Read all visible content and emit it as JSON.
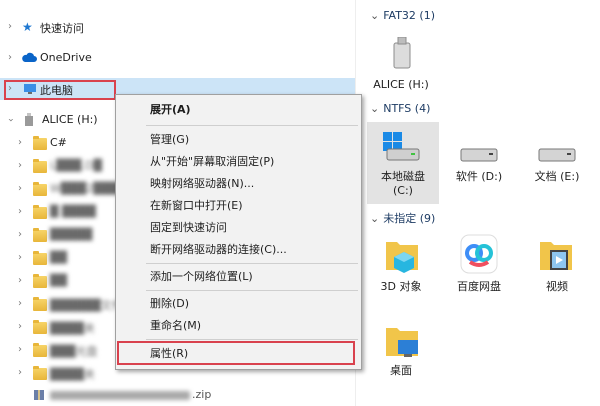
{
  "nav": {
    "quick_access": "快速访问",
    "onedrive": "OneDrive",
    "this_pc": "此电脑",
    "drive": "ALICE (H:)",
    "folders": [
      "C#",
      "L███.D█",
      "W███2███",
      "█ ████",
      "█████",
      "██",
      "██",
      "██████文件",
      "████夹",
      "███光盘",
      "████夹"
    ],
    "zip_suffix": ".zip"
  },
  "content": {
    "groups": [
      {
        "title": "FAT32 (1)",
        "items": [
          {
            "label": "ALICE (H:)",
            "icon": "usb-drive-icon"
          }
        ]
      },
      {
        "title": "NTFS (4)",
        "items": [
          {
            "label": "本地磁盘\n(C:)",
            "icon": "windows-drive-icon"
          },
          {
            "label": "软件 (D:)",
            "icon": "hard-drive-icon"
          },
          {
            "label": "文档 (E:)",
            "icon": "hard-drive-icon"
          }
        ]
      },
      {
        "title": "未指定 (9)",
        "items": [
          {
            "label": "3D 对象",
            "icon": "3d-objects-folder-icon"
          },
          {
            "label": "百度网盘",
            "icon": "baidu-netdisk-icon"
          },
          {
            "label": "视频",
            "icon": "video-folder-icon"
          },
          {
            "label": "桌面",
            "icon": "desktop-folder-icon"
          }
        ]
      }
    ]
  },
  "context_menu": {
    "items": [
      "展开(A)",
      "管理(G)",
      "从\"开始\"屏幕取消固定(P)",
      "映射网络驱动器(N)...",
      "在新窗口中打开(E)",
      "固定到快速访问",
      "断开网络驱动器的连接(C)...",
      "添加一个网络位置(L)",
      "删除(D)",
      "重命名(M)",
      "属性(R)"
    ]
  },
  "colors": {
    "highlight": "#d9424e",
    "selection": "#cce4f7",
    "folder": "#e8b63a",
    "accent": "#0078d7"
  }
}
